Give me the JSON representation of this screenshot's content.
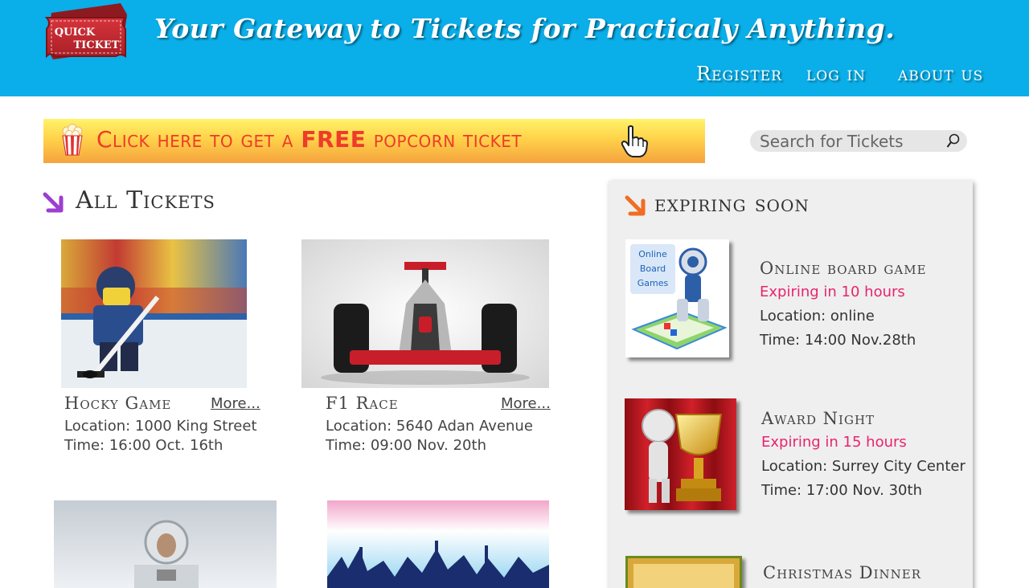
{
  "header": {
    "logo_line1": "QUICK",
    "logo_line2": "TICKET",
    "tagline": "Your Gateway to Tickets for Practicaly Anything.",
    "nav": {
      "register": "Register",
      "login": "log in",
      "about": "about us"
    }
  },
  "promo": {
    "text_before": "Click here to get a ",
    "text_bold": "FREE",
    "text_after": " popcorn ticket"
  },
  "search": {
    "placeholder": "Search for Tickets"
  },
  "all_tickets": {
    "title": "All Tickets",
    "more_label": "More...",
    "items": [
      {
        "name": "Hocky Game",
        "location": "Location: 1000 King Street",
        "time": "Time: 16:00 Oct. 16th"
      },
      {
        "name": "F1 Race",
        "location": "Location: 5640 Adan Avenue",
        "time": "Time: 09:00 Nov. 20th"
      }
    ]
  },
  "expiring": {
    "title": "expiring soon",
    "items": [
      {
        "name": "Online board game",
        "expires": "Expiring in 10 hours",
        "location": "Location: online",
        "time": "Time: 14:00 Nov.28th",
        "image_text": [
          "Online",
          "Board",
          "Games"
        ]
      },
      {
        "name": "Award Night",
        "expires": "Expiring in 15 hours",
        "location": "Location: Surrey City Center",
        "time": "Time: 17:00 Nov. 30th"
      },
      {
        "name": "Christmas Dinner"
      }
    ]
  },
  "colors": {
    "header_bg": "#0aaee8",
    "promo_text": "#ee3b2a",
    "expiring_text": "#e8246c",
    "sidebar_bg": "#efefef"
  }
}
